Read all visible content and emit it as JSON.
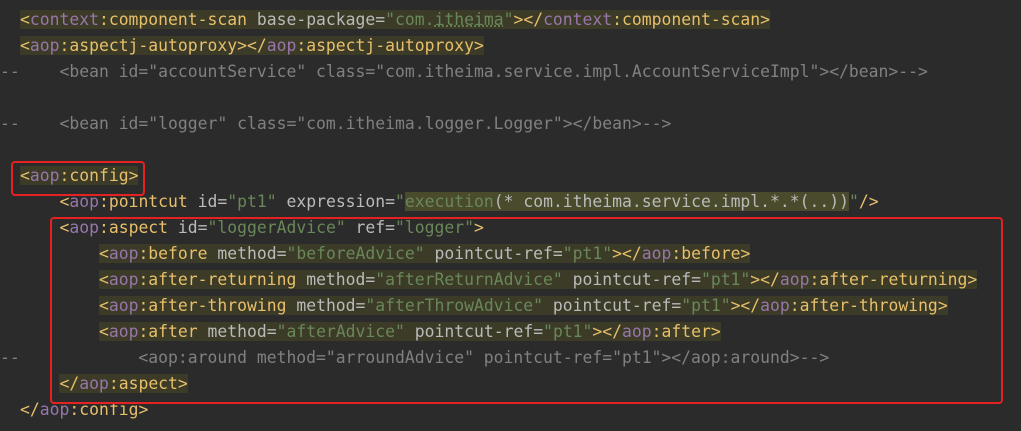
{
  "lines": [
    {
      "gutter": "",
      "indent": "",
      "parts": [
        {
          "t": "<",
          "c": "lt"
        },
        {
          "t": "context",
          "c": "ns"
        },
        {
          "t": ":component-scan",
          "c": "tag"
        },
        {
          "t": " base-package",
          "c": "attr"
        },
        {
          "t": "=",
          "c": "attr"
        },
        {
          "t": "\"com.",
          "c": "str"
        },
        {
          "t": "itheima",
          "c": "str pkg-under"
        },
        {
          "t": "\"",
          "c": "str"
        },
        {
          "t": "></",
          "c": "lt"
        },
        {
          "t": "context",
          "c": "ns"
        },
        {
          "t": ":component-scan",
          "c": "tag"
        },
        {
          "t": ">",
          "c": "lt"
        }
      ],
      "highlight": true
    },
    {
      "gutter": "",
      "indent": "",
      "parts": [
        {
          "t": "<",
          "c": "lt"
        },
        {
          "t": "aop",
          "c": "ns"
        },
        {
          "t": ":aspectj-autoproxy",
          "c": "tag"
        },
        {
          "t": "></",
          "c": "lt"
        },
        {
          "t": "aop",
          "c": "ns"
        },
        {
          "t": ":aspectj-autoproxy",
          "c": "tag"
        },
        {
          "t": ">",
          "c": "lt"
        }
      ],
      "highlight": true
    },
    {
      "gutter": "--",
      "indent": "    ",
      "parts": [
        {
          "t": "<bean id=\"accountService\" class=\"com.itheima.service.impl.AccountServiceImpl\"></bean>-->",
          "c": "cmt"
        }
      ],
      "highlight": false
    },
    {
      "gutter": "",
      "indent": "",
      "parts": [],
      "highlight": false
    },
    {
      "gutter": "--",
      "indent": "    ",
      "parts": [
        {
          "t": "<bean id=\"logger\" class=\"com.itheima.logger.Logger\"></bean>-->",
          "c": "cmt"
        }
      ],
      "highlight": false
    },
    {
      "gutter": "",
      "indent": "",
      "parts": [],
      "highlight": false
    },
    {
      "gutter": "",
      "indent": "",
      "parts": [
        {
          "t": "<",
          "c": "lt"
        },
        {
          "t": "aop",
          "c": "ns"
        },
        {
          "t": ":config",
          "c": "tag"
        },
        {
          "t": ">",
          "c": "lt"
        }
      ],
      "highlight": true
    },
    {
      "gutter": "",
      "indent": "    ",
      "parts": [
        {
          "t": "<",
          "c": "lt"
        },
        {
          "t": "aop",
          "c": "ns"
        },
        {
          "t": ":pointcut",
          "c": "tag"
        },
        {
          "t": " id",
          "c": "attr"
        },
        {
          "t": "=",
          "c": "attr"
        },
        {
          "t": "\"pt1\"",
          "c": "str"
        },
        {
          "t": " expression",
          "c": "attr"
        },
        {
          "t": "=",
          "c": "attr"
        },
        {
          "t": "\"",
          "c": "str"
        },
        {
          "t": "execution",
          "c": "str hl2"
        },
        {
          "t": "(* com.itheima.service.impl.*.*(..))",
          "c": "attr hl2"
        },
        {
          "t": "\"",
          "c": "str"
        },
        {
          "t": "/>",
          "c": "lt"
        }
      ],
      "highlight": false
    },
    {
      "gutter": "",
      "indent": "    ",
      "parts": [
        {
          "t": "<",
          "c": "lt"
        },
        {
          "t": "aop",
          "c": "ns"
        },
        {
          "t": ":aspect",
          "c": "tag"
        },
        {
          "t": " id",
          "c": "attr"
        },
        {
          "t": "=",
          "c": "attr"
        },
        {
          "t": "\"loggerAdvice\"",
          "c": "str"
        },
        {
          "t": " ref",
          "c": "attr"
        },
        {
          "t": "=",
          "c": "attr"
        },
        {
          "t": "\"logger\"",
          "c": "str"
        },
        {
          "t": ">",
          "c": "lt"
        }
      ],
      "highlight": false
    },
    {
      "gutter": "",
      "indent": "        ",
      "parts": [
        {
          "t": "<",
          "c": "lt"
        },
        {
          "t": "aop",
          "c": "ns"
        },
        {
          "t": ":before",
          "c": "tag"
        },
        {
          "t": " method",
          "c": "attr"
        },
        {
          "t": "=",
          "c": "attr"
        },
        {
          "t": "\"beforeAdvice\"",
          "c": "str"
        },
        {
          "t": " pointcut-ref",
          "c": "attr"
        },
        {
          "t": "=",
          "c": "attr"
        },
        {
          "t": "\"pt1\"",
          "c": "str"
        },
        {
          "t": "></",
          "c": "lt"
        },
        {
          "t": "aop",
          "c": "ns"
        },
        {
          "t": ":before",
          "c": "tag"
        },
        {
          "t": ">",
          "c": "lt"
        }
      ],
      "highlight": true
    },
    {
      "gutter": "",
      "indent": "        ",
      "parts": [
        {
          "t": "<",
          "c": "lt"
        },
        {
          "t": "aop",
          "c": "ns"
        },
        {
          "t": ":after-returning",
          "c": "tag"
        },
        {
          "t": " method",
          "c": "attr"
        },
        {
          "t": "=",
          "c": "attr"
        },
        {
          "t": "\"afterReturnAdvice\"",
          "c": "str"
        },
        {
          "t": " pointcut-ref",
          "c": "attr"
        },
        {
          "t": "=",
          "c": "attr"
        },
        {
          "t": "\"pt1\"",
          "c": "str"
        },
        {
          "t": "></",
          "c": "lt"
        },
        {
          "t": "aop",
          "c": "ns"
        },
        {
          "t": ":after-returning",
          "c": "tag"
        },
        {
          "t": ">",
          "c": "lt"
        }
      ],
      "highlight": true
    },
    {
      "gutter": "",
      "indent": "        ",
      "parts": [
        {
          "t": "<",
          "c": "lt"
        },
        {
          "t": "aop",
          "c": "ns"
        },
        {
          "t": ":after-throwing",
          "c": "tag"
        },
        {
          "t": " method",
          "c": "attr"
        },
        {
          "t": "=",
          "c": "attr"
        },
        {
          "t": "\"afterThrowAdvice\"",
          "c": "str"
        },
        {
          "t": " pointcut-ref",
          "c": "attr"
        },
        {
          "t": "=",
          "c": "attr"
        },
        {
          "t": "\"pt1\"",
          "c": "str"
        },
        {
          "t": "></",
          "c": "lt"
        },
        {
          "t": "aop",
          "c": "ns"
        },
        {
          "t": ":after-throwing",
          "c": "tag"
        },
        {
          "t": ">",
          "c": "lt"
        }
      ],
      "highlight": true
    },
    {
      "gutter": "",
      "indent": "        ",
      "parts": [
        {
          "t": "<",
          "c": "lt"
        },
        {
          "t": "aop",
          "c": "ns"
        },
        {
          "t": ":after",
          "c": "tag"
        },
        {
          "t": " method",
          "c": "attr"
        },
        {
          "t": "=",
          "c": "attr"
        },
        {
          "t": "\"afterAdvice\"",
          "c": "str"
        },
        {
          "t": " pointcut-ref",
          "c": "attr"
        },
        {
          "t": "=",
          "c": "attr"
        },
        {
          "t": "\"pt1\"",
          "c": "str"
        },
        {
          "t": "></",
          "c": "lt"
        },
        {
          "t": "aop",
          "c": "ns"
        },
        {
          "t": ":after",
          "c": "tag"
        },
        {
          "t": ">",
          "c": "lt"
        }
      ],
      "highlight": true
    },
    {
      "gutter": "--",
      "indent": "            ",
      "parts": [
        {
          "t": "<aop:around method=\"arroundAdvice\" pointcut-ref=\"pt1\"></aop:around>-->",
          "c": "cmt"
        }
      ],
      "highlight": false
    },
    {
      "gutter": "",
      "indent": "    ",
      "parts": [
        {
          "t": "</",
          "c": "lt"
        },
        {
          "t": "aop",
          "c": "ns"
        },
        {
          "t": ":aspect",
          "c": "tag"
        },
        {
          "t": ">",
          "c": "lt"
        }
      ],
      "highlight": true
    },
    {
      "gutter": "",
      "indent": "",
      "parts": [
        {
          "t": "</",
          "c": "lt"
        },
        {
          "t": "aop",
          "c": "ns"
        },
        {
          "t": ":config",
          "c": "tag"
        },
        {
          "t": ">",
          "c": "lt"
        }
      ],
      "highlight": false
    }
  ],
  "annotations": {
    "config_box_color": "#e52222",
    "aspect_box_color": "#e52222"
  }
}
